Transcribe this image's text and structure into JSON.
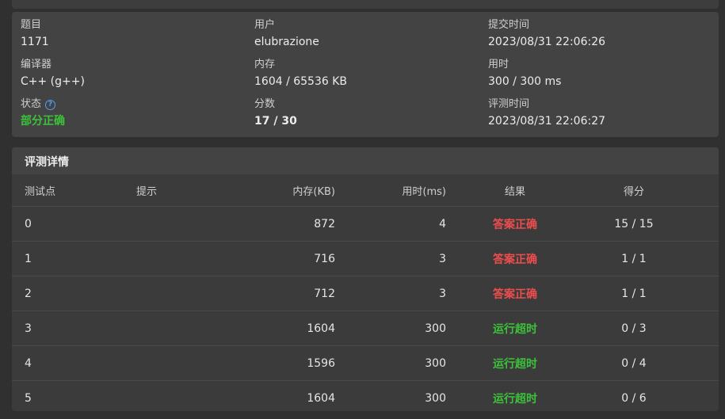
{
  "colors": {
    "accepted": "#ef4d4d",
    "timeout": "#3cc13b",
    "partial": "#3cc13b",
    "help": "#4f9ef0"
  },
  "info": {
    "problem_label": "题目",
    "problem_value": "1171",
    "user_label": "用户",
    "user_value": "elubrazione",
    "submit_time_label": "提交时间",
    "submit_time_value": "2023/08/31 22:06:26",
    "compiler_label": "编译器",
    "compiler_value": "C++ (g++)",
    "memory_label": "内存",
    "memory_value": "1604 / 65536 KB",
    "time_label": "用时",
    "time_value": "300 / 300 ms",
    "status_label": "状态",
    "status_value": "部分正确",
    "help_icon": "question-circle-icon",
    "score_label": "分数",
    "score_value": "17 / 30",
    "judge_time_label": "评测时间",
    "judge_time_value": "2023/08/31 22:06:27"
  },
  "details": {
    "title": "评测详情",
    "headers": {
      "id": "测试点",
      "hint": "提示",
      "memory": "内存(KB)",
      "time": "用时(ms)",
      "result": "结果",
      "score": "得分"
    },
    "rows": [
      {
        "id": "0",
        "hint": "",
        "memory": "872",
        "time": "4",
        "result": "答案正确",
        "type": "accepted",
        "score": "15 / 15"
      },
      {
        "id": "1",
        "hint": "",
        "memory": "716",
        "time": "3",
        "result": "答案正确",
        "type": "accepted",
        "score": "1 / 1"
      },
      {
        "id": "2",
        "hint": "",
        "memory": "712",
        "time": "3",
        "result": "答案正确",
        "type": "accepted",
        "score": "1 / 1"
      },
      {
        "id": "3",
        "hint": "",
        "memory": "1604",
        "time": "300",
        "result": "运行超时",
        "type": "timeout",
        "score": "0 / 3"
      },
      {
        "id": "4",
        "hint": "",
        "memory": "1596",
        "time": "300",
        "result": "运行超时",
        "type": "timeout",
        "score": "0 / 4"
      },
      {
        "id": "5",
        "hint": "",
        "memory": "1604",
        "time": "300",
        "result": "运行超时",
        "type": "timeout",
        "score": "0 / 6"
      }
    ]
  }
}
